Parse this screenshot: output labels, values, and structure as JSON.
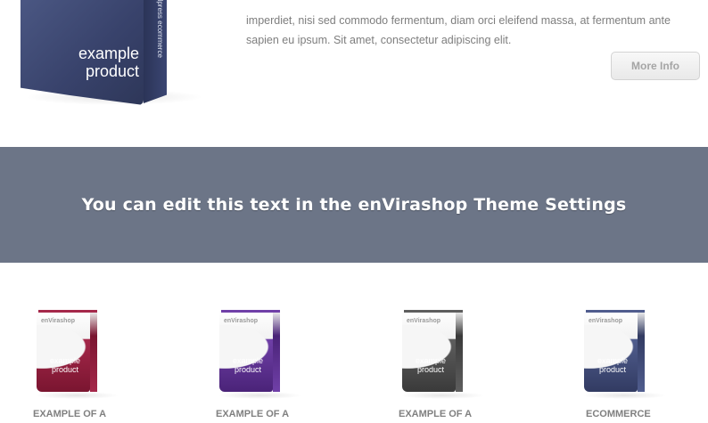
{
  "hero": {
    "product_title_line1": "example",
    "product_title_line2": "product",
    "vertical_label": "wordpress ecommerce",
    "colors": {
      "box": "#3e4872"
    }
  },
  "intro": {
    "line1": "imperdiet, nisi sed commodo fermentum, diam orci eleifend massa, at fermentum ante",
    "line2": "sapien eu ipsum. Sit amet, consectetur adipiscing elit."
  },
  "more_info_label": "More Info",
  "banner": {
    "text": "You can edit this text in the enVirashop Theme Settings",
    "background": "#6c7587"
  },
  "products": [
    {
      "name": "EXAMPLE OF A",
      "box_brand": "enVirashop",
      "box_label_1": "example",
      "box_label_2": "product",
      "color": "#8b1d3a"
    },
    {
      "name": "EXAMPLE OF A",
      "box_brand": "enVirashop",
      "box_label_1": "example",
      "box_label_2": "product",
      "color": "#5a2e8a"
    },
    {
      "name": "EXAMPLE OF A",
      "box_brand": "enVirashop",
      "box_label_1": "example",
      "box_label_2": "product",
      "color": "#4a4a4a"
    },
    {
      "name": "ECOMMERCE",
      "box_brand": "enVirashop",
      "box_label_1": "example",
      "box_label_2": "product",
      "color": "#3e4872"
    }
  ]
}
